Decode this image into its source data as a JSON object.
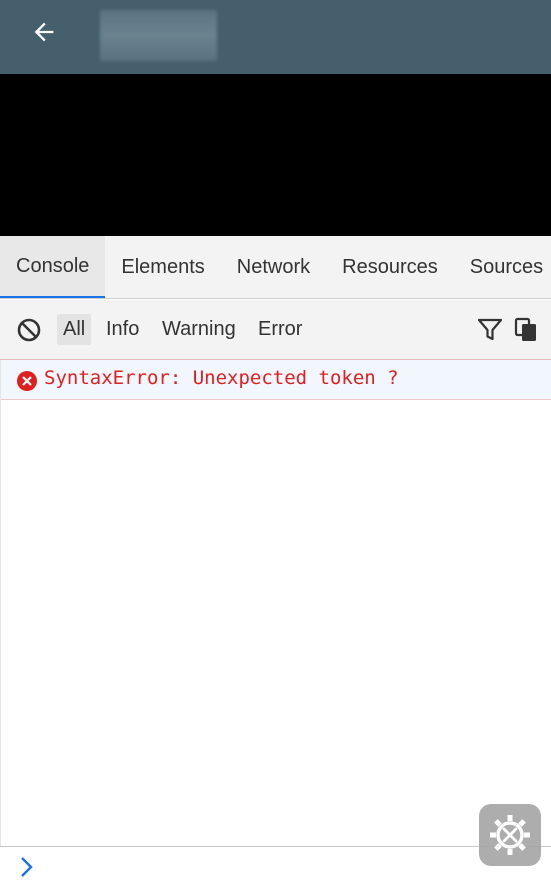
{
  "appbar": {
    "back_icon": "arrow-left-icon",
    "background": "#455f6c"
  },
  "devtools": {
    "tabs": [
      {
        "label": "Console",
        "active": true
      },
      {
        "label": "Elements",
        "active": false
      },
      {
        "label": "Network",
        "active": false
      },
      {
        "label": "Resources",
        "active": false
      },
      {
        "label": "Sources",
        "active": false
      }
    ],
    "accent": "#1a73e8",
    "filter": {
      "clear_icon": "clear-console-icon",
      "levels": [
        {
          "label": "All",
          "selected": true
        },
        {
          "label": "Info",
          "selected": false
        },
        {
          "label": "Warning",
          "selected": false
        },
        {
          "label": "Error",
          "selected": false
        }
      ],
      "filter_icon": "funnel-icon",
      "copy_icon": "copy-icon"
    },
    "messages": [
      {
        "level": "error",
        "icon": "error-circle-icon",
        "text": "SyntaxError: Unexpected token ?",
        "color": "#e0201f"
      }
    ],
    "prompt_icon": "chevron-right-icon"
  },
  "fab": {
    "icon": "settings-tools-icon"
  }
}
